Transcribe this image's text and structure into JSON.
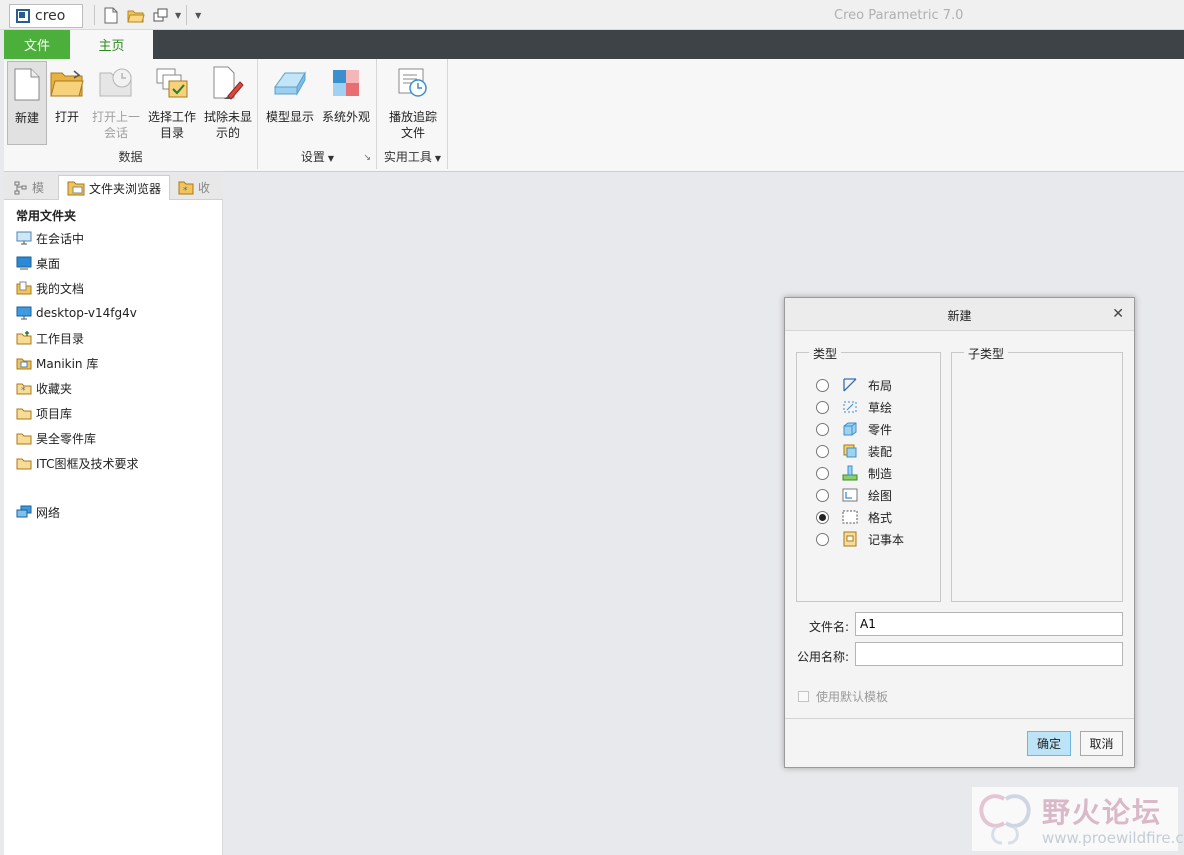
{
  "app": {
    "logo": "creo",
    "title": "Creo Parametric 7.0"
  },
  "ribbon": {
    "tabs": {
      "file": "文件",
      "home": "主页"
    },
    "buttons": {
      "new": "新建",
      "open": "打开",
      "open_last": "打开上一会话",
      "select_dir": "选择工作目录",
      "erase": "拭除未显示的",
      "model_display": "模型显示",
      "system_appearance": "系统外观",
      "playback": "播放追踪文件"
    },
    "groups": {
      "data": "数据",
      "settings": "设置",
      "utilities": "实用工具"
    }
  },
  "panel": {
    "tabs": {
      "model": "模",
      "folder_browser": "文件夹浏览器",
      "favorites": "收"
    },
    "favorites_title": "常用文件夹",
    "items": [
      "在会话中",
      "桌面",
      "我的文档",
      "desktop-v14fg4v",
      "工作目录",
      "Manikin 库",
      "收藏夹",
      "项目库",
      "昊全零件库",
      "ITC图框及技术要求"
    ],
    "network": "网络"
  },
  "dialog": {
    "title": "新建",
    "type_legend": "类型",
    "subtype_legend": "子类型",
    "types": [
      "布局",
      "草绘",
      "零件",
      "装配",
      "制造",
      "绘图",
      "格式",
      "记事本"
    ],
    "selected_type": "格式",
    "filename_label": "文件名:",
    "filename_value": "A1",
    "common_name_label": "公用名称:",
    "common_name_value": "",
    "use_default_template": "使用默认模板",
    "ok": "确定",
    "cancel": "取消"
  },
  "watermark": {
    "text": "野火论坛",
    "url": "www.proewildfire.cn"
  }
}
